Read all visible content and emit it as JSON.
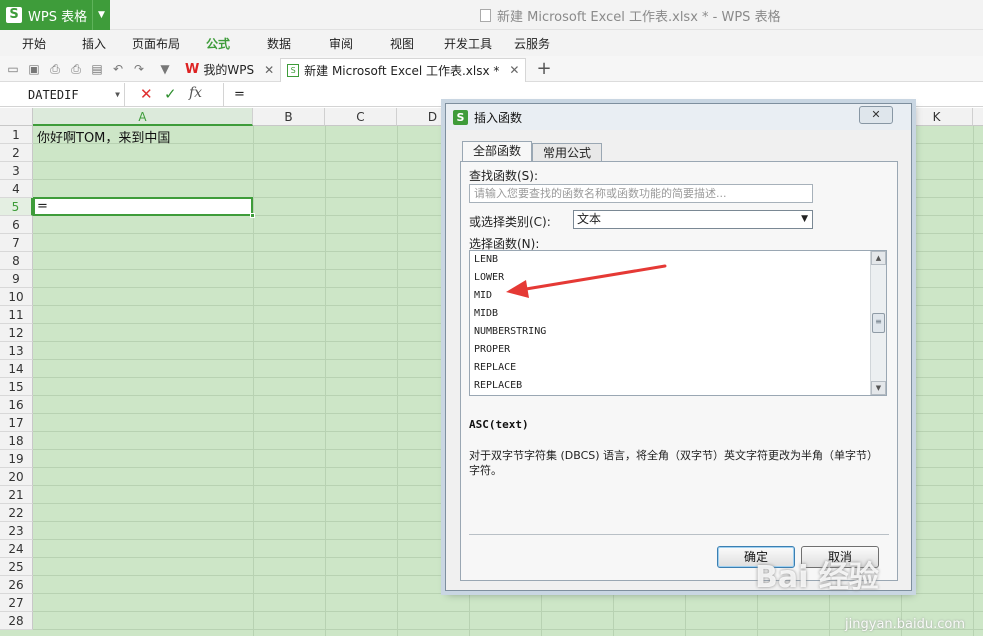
{
  "app": {
    "name": "WPS 表格",
    "window_title": "新建 Microsoft Excel 工作表.xlsx * - WPS 表格"
  },
  "menu": {
    "items": [
      "开始",
      "插入",
      "页面布局",
      "公式",
      "数据",
      "审阅",
      "视图",
      "开发工具",
      "云服务"
    ],
    "active": "公式"
  },
  "tabs": [
    {
      "label": "我的WPS"
    },
    {
      "label": "新建 Microsoft Excel 工作表.xlsx *"
    }
  ],
  "formula_bar": {
    "name_box": "DATEDIF",
    "formula": "="
  },
  "grid": {
    "columns": [
      "A",
      "B",
      "C",
      "D",
      "K"
    ],
    "rows": [
      "1",
      "2",
      "3",
      "4",
      "5",
      "6",
      "7",
      "8",
      "9",
      "10",
      "11",
      "12",
      "13",
      "14",
      "15",
      "16",
      "17",
      "18",
      "19",
      "20",
      "21",
      "22",
      "23",
      "24",
      "25",
      "26",
      "27",
      "28"
    ],
    "cell_a1": "你好啊TOM，来到中国",
    "cell_a5": "="
  },
  "dialog": {
    "title": "插入函数",
    "close_label": "✕",
    "tab_all": "全部函数",
    "tab_common": "常用公式",
    "search_label": "查找函数(S):",
    "search_placeholder": "请输入您要查找的函数名称或函数功能的简要描述...",
    "category_label": "或选择类别(C):",
    "category_value": "文本",
    "function_label": "选择函数(N):",
    "functions": [
      "LENB",
      "LOWER",
      "MID",
      "MIDB",
      "NUMBERSTRING",
      "PROPER",
      "REPLACE",
      "REPLACEB"
    ],
    "description_title": "ASC(text)",
    "description": "对于双字节字符集 (DBCS) 语言，将全角（双字节）英文字符更改为半角（单字节）字符。",
    "ok_label": "确定",
    "cancel_label": "取消"
  },
  "watermark": {
    "logo": "Bai 经验",
    "url": "jingyan.baidu.com"
  },
  "colors": {
    "accent": "#3e9c3a",
    "grid_fill": "#cde6c7",
    "annotation_arrow": "#e53935"
  }
}
